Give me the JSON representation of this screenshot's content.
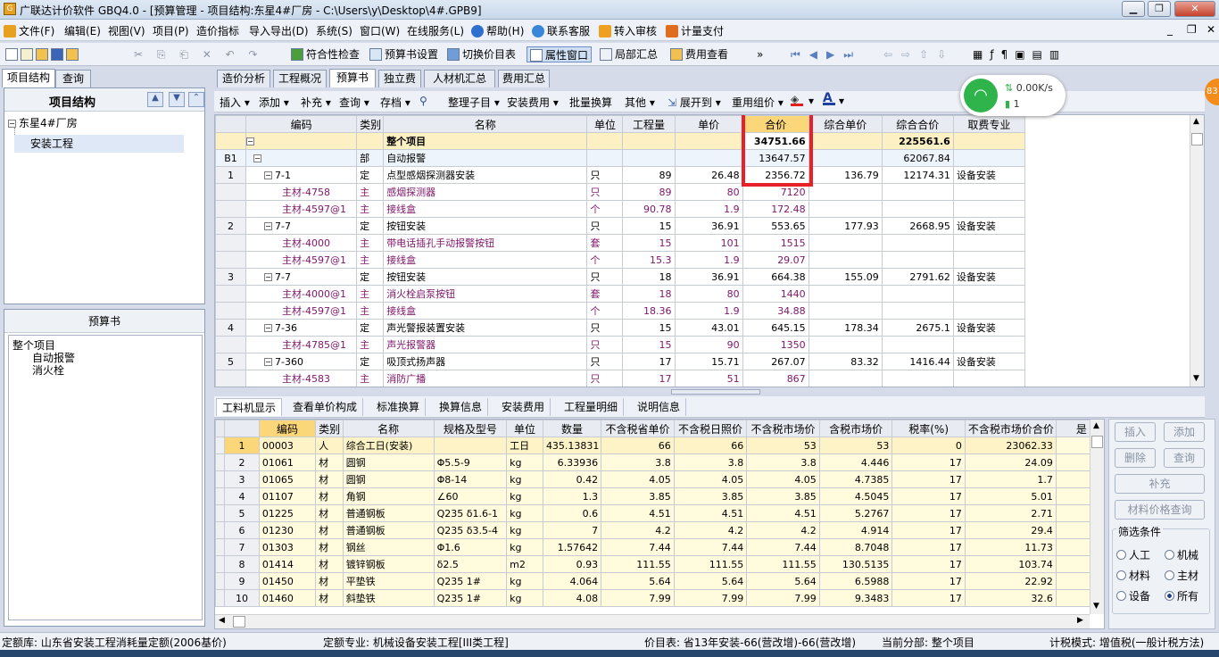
{
  "window": {
    "title": "广联达计价软件 GBQ4.0 - [预算管理 - 项目结构:东星4#厂房 - C:\\Users\\y\\Desktop\\4#.GPB9]"
  },
  "menu": {
    "items": [
      "文件(F)",
      "编辑(E)",
      "视图(V)",
      "项目(P)",
      "造价指标",
      "导入导出(D)",
      "系统(S)",
      "窗口(W)",
      "在线服务(L)",
      "帮助(H)",
      "联系客服",
      "转入审核",
      "计量支付"
    ]
  },
  "toolbar": {
    "items": [
      "符合性检查",
      "预算书设置",
      "切换价目表",
      "属性窗口",
      "局部汇总",
      "费用查看"
    ]
  },
  "left": {
    "tabs": [
      "项目结构",
      "查询"
    ],
    "project_header": "项目结构",
    "tree": [
      "东星4#厂房",
      "安装工程"
    ],
    "budget_header": "预算书",
    "budget_tree": [
      "整个项目",
      "自动报警",
      "消火栓"
    ]
  },
  "doc_tabs": [
    "造价分析",
    "工程概况",
    "预算书",
    "独立费",
    "人材机汇总",
    "费用汇总"
  ],
  "action_bar": [
    "插入",
    "添加",
    "补充",
    "查询",
    "存档",
    "整理子目",
    "安装费用",
    "批量换算",
    "其他",
    "展开到",
    "重用组价"
  ],
  "network": {
    "speed": "0.00K/s",
    "count": "1",
    "badge": "83"
  },
  "main_grid": {
    "headers": [
      "编码",
      "类别",
      "名称",
      "单位",
      "工程量",
      "单价",
      "合价",
      "综合单价",
      "综合合价",
      "取费专业"
    ],
    "rows": [
      {
        "no": "",
        "code": "",
        "type": "",
        "name": "整个项目",
        "unit": "",
        "qty": "",
        "price": "",
        "total": "34751.66",
        "cprice": "",
        "ctotal": "225561.6",
        "spec": ""
      },
      {
        "no": "B1",
        "code": "",
        "type": "部",
        "name": "自动报警",
        "unit": "",
        "qty": "",
        "price": "",
        "total": "13647.57",
        "cprice": "",
        "ctotal": "62067.84",
        "spec": ""
      },
      {
        "no": "1",
        "code": "7-1",
        "type": "定",
        "name": "点型感烟探测器安装",
        "unit": "只",
        "qty": "89",
        "price": "26.48",
        "total": "2356.72",
        "cprice": "136.79",
        "ctotal": "12174.31",
        "spec": "设备安装"
      },
      {
        "no": "",
        "code": "主材-4758",
        "type": "主",
        "name": "感烟探测器",
        "unit": "只",
        "qty": "89",
        "price": "80",
        "total": "7120",
        "cprice": "",
        "ctotal": "",
        "spec": ""
      },
      {
        "no": "",
        "code": "主材-4597@1",
        "type": "主",
        "name": "接线盒",
        "unit": "个",
        "qty": "90.78",
        "price": "1.9",
        "total": "172.48",
        "cprice": "",
        "ctotal": "",
        "spec": ""
      },
      {
        "no": "2",
        "code": "7-7",
        "type": "定",
        "name": "按钮安装",
        "unit": "只",
        "qty": "15",
        "price": "36.91",
        "total": "553.65",
        "cprice": "177.93",
        "ctotal": "2668.95",
        "spec": "设备安装"
      },
      {
        "no": "",
        "code": "主材-4000",
        "type": "主",
        "name": "带电话插孔手动报警按钮",
        "unit": "套",
        "qty": "15",
        "price": "101",
        "total": "1515",
        "cprice": "",
        "ctotal": "",
        "spec": ""
      },
      {
        "no": "",
        "code": "主材-4597@1",
        "type": "主",
        "name": "接线盒",
        "unit": "个",
        "qty": "15.3",
        "price": "1.9",
        "total": "29.07",
        "cprice": "",
        "ctotal": "",
        "spec": ""
      },
      {
        "no": "3",
        "code": "7-7",
        "type": "定",
        "name": "按钮安装",
        "unit": "只",
        "qty": "18",
        "price": "36.91",
        "total": "664.38",
        "cprice": "155.09",
        "ctotal": "2791.62",
        "spec": "设备安装"
      },
      {
        "no": "",
        "code": "主材-4000@1",
        "type": "主",
        "name": "消火栓启泵按钮",
        "unit": "套",
        "qty": "18",
        "price": "80",
        "total": "1440",
        "cprice": "",
        "ctotal": "",
        "spec": ""
      },
      {
        "no": "",
        "code": "主材-4597@1",
        "type": "主",
        "name": "接线盒",
        "unit": "个",
        "qty": "18.36",
        "price": "1.9",
        "total": "34.88",
        "cprice": "",
        "ctotal": "",
        "spec": ""
      },
      {
        "no": "4",
        "code": "7-36",
        "type": "定",
        "name": "声光警报装置安装",
        "unit": "只",
        "qty": "15",
        "price": "43.01",
        "total": "645.15",
        "cprice": "178.34",
        "ctotal": "2675.1",
        "spec": "设备安装"
      },
      {
        "no": "",
        "code": "主材-4785@1",
        "type": "主",
        "name": "声光报警器",
        "unit": "只",
        "qty": "15",
        "price": "90",
        "total": "1350",
        "cprice": "",
        "ctotal": "",
        "spec": ""
      },
      {
        "no": "5",
        "code": "7-360",
        "type": "定",
        "name": "吸顶式扬声器",
        "unit": "只",
        "qty": "17",
        "price": "15.71",
        "total": "267.07",
        "cprice": "83.32",
        "ctotal": "1416.44",
        "spec": "设备安装"
      },
      {
        "no": "",
        "code": "主材-4583",
        "type": "主",
        "name": "消防广播",
        "unit": "只",
        "qty": "17",
        "price": "51",
        "total": "867",
        "cprice": "",
        "ctotal": "",
        "spec": ""
      }
    ]
  },
  "sub_tabs": [
    "工料机显示",
    "查看单价构成",
    "标准换算",
    "换算信息",
    "安装费用",
    "工程量明细",
    "说明信息"
  ],
  "lower_grid": {
    "headers": [
      "编码",
      "类别",
      "名称",
      "规格及型号",
      "单位",
      "数量",
      "不含税省单价",
      "不含税日照价",
      "不含税市场价",
      "含税市场价",
      "税率(%)",
      "不含税市场价合价",
      "是"
    ],
    "rows": [
      [
        "1",
        "00003",
        "人",
        "综合工日(安装)",
        "",
        "工日",
        "435.13831",
        "66",
        "66",
        "53",
        "53",
        "0",
        "23062.33"
      ],
      [
        "2",
        "01061",
        "材",
        "圆钢",
        "Φ5.5-9",
        "kg",
        "6.33936",
        "3.8",
        "3.8",
        "3.8",
        "4.446",
        "17",
        "24.09"
      ],
      [
        "3",
        "01065",
        "材",
        "圆钢",
        "Φ8-14",
        "kg",
        "0.42",
        "4.05",
        "4.05",
        "4.05",
        "4.7385",
        "17",
        "1.7"
      ],
      [
        "4",
        "01107",
        "材",
        "角钢",
        "∠60",
        "kg",
        "1.3",
        "3.85",
        "3.85",
        "3.85",
        "4.5045",
        "17",
        "5.01"
      ],
      [
        "5",
        "01225",
        "材",
        "普通钢板",
        "Q235 δ1.6-1",
        "kg",
        "0.6",
        "4.51",
        "4.51",
        "4.51",
        "5.2767",
        "17",
        "2.71"
      ],
      [
        "6",
        "01230",
        "材",
        "普通钢板",
        "Q235 δ3.5-4",
        "kg",
        "7",
        "4.2",
        "4.2",
        "4.2",
        "4.914",
        "17",
        "29.4"
      ],
      [
        "7",
        "01303",
        "材",
        "钢丝",
        "Φ1.6",
        "kg",
        "1.57642",
        "7.44",
        "7.44",
        "7.44",
        "8.7048",
        "17",
        "11.73"
      ],
      [
        "8",
        "01414",
        "材",
        "镀锌钢板",
        "δ2.5",
        "m2",
        "0.93",
        "111.55",
        "111.55",
        "111.55",
        "130.5135",
        "17",
        "103.74"
      ],
      [
        "9",
        "01450",
        "材",
        "平垫铁",
        "Q235 1#",
        "kg",
        "4.064",
        "5.64",
        "5.64",
        "5.64",
        "6.5988",
        "17",
        "22.92"
      ],
      [
        "10",
        "01460",
        "材",
        "斜垫铁",
        "Q235 1#",
        "kg",
        "4.08",
        "7.99",
        "7.99",
        "7.99",
        "9.3483",
        "17",
        "32.6"
      ]
    ]
  },
  "right_panel": {
    "buttons": [
      "插入",
      "添加",
      "删除",
      "查询",
      "补充",
      "材料价格查询"
    ],
    "filter_title": "筛选条件",
    "filters": [
      "人工",
      "机械",
      "材料",
      "主材",
      "设备",
      "所有"
    ]
  },
  "status": {
    "quota_lib": "定额库: 山东省安装工程消耗量定额(2006基价)",
    "quota_spec": "定额专业: 机械设备安装工程[III类工程]",
    "price_table": "价目表: 省13年安装-66(营改增)-66(营改增)",
    "current": "当前分部: 整个项目",
    "tax_mode": "计税模式: 增值税(一般计税方法)"
  },
  "colors": {
    "highlight_red": "#e8202a",
    "selected_row": "#fdf0c2",
    "header_yellow": "#fbd77a",
    "purple_text": "#80186c",
    "lower_row_bg": "#fffbdc"
  }
}
